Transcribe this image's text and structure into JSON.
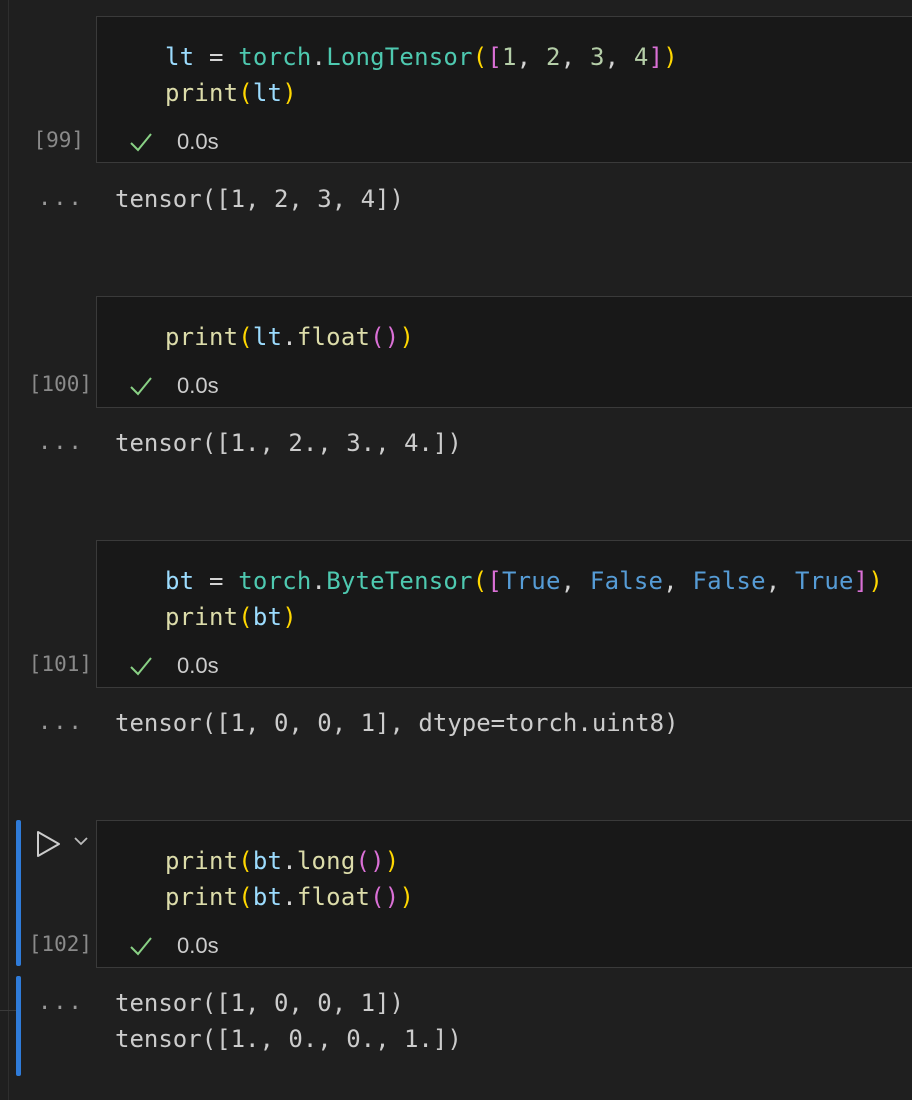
{
  "cells": [
    {
      "exec_count": "[99]",
      "status_time": "0.0s",
      "output": [
        "tensor([1, 2, 3, 4])"
      ]
    },
    {
      "exec_count": "[100]",
      "status_time": "0.0s",
      "output": [
        "tensor([1., 2., 3., 4.])"
      ]
    },
    {
      "exec_count": "[101]",
      "status_time": "0.0s",
      "output": [
        "tensor([1, 0, 0, 1], dtype=torch.uint8)"
      ]
    },
    {
      "exec_count": "[102]",
      "status_time": "0.0s",
      "output": [
        "tensor([1, 0, 0, 1])",
        "tensor([1., 0., 0., 1.])"
      ]
    }
  ],
  "output_more": "...",
  "colors": {
    "focus_accent": "#2f7bd8",
    "success_check": "#89d185"
  }
}
